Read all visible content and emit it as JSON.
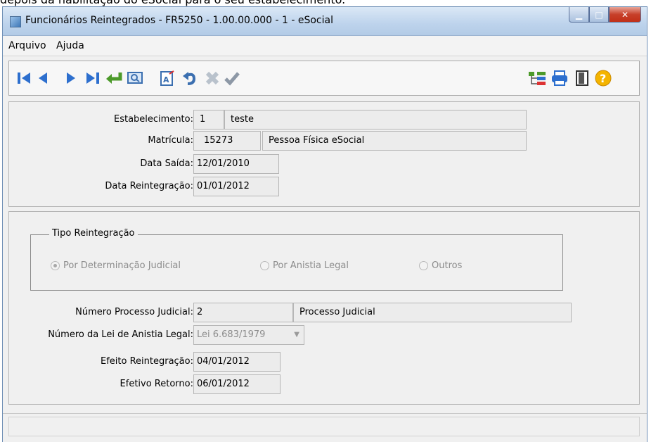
{
  "caption": "depois da habilitação do eSocial para o seu estabelecimento.",
  "window": {
    "title": "Funcionários Reintegrados - FR5250 - 1.00.00.000 - 1 - eSocial"
  },
  "menu": [
    "Arquivo",
    "Ajuda"
  ],
  "toolbar_icons": {
    "left": [
      "first-record-icon",
      "previous-record-icon",
      "next-record-icon",
      "last-record-icon",
      "goto-icon",
      "search-icon",
      "edit-icon",
      "undo-icon",
      "delete-icon",
      "confirm-icon"
    ],
    "right": [
      "tree-icon",
      "print-icon",
      "exit-icon",
      "help-icon"
    ]
  },
  "fields": {
    "estabelecimento": {
      "label": "Estabelecimento:",
      "code": "1",
      "name": "teste"
    },
    "matricula": {
      "label": "Matrícula:",
      "code": "15273",
      "name": "Pessoa Física eSocial"
    },
    "data_saida": {
      "label": "Data Saída:",
      "value": "12/01/2010"
    },
    "data_reintegracao": {
      "label": "Data Reintegração:",
      "value": "01/01/2012"
    }
  },
  "tipo_reintegracao": {
    "title": "Tipo Reintegração",
    "options": [
      "Por Determinação Judicial",
      "Por Anistia Legal",
      "Outros"
    ],
    "selected": "Por Determinação Judicial"
  },
  "processo": {
    "numero": {
      "label": "Número Processo Judicial:",
      "value": "2",
      "desc": "Processo Judicial"
    },
    "lei": {
      "label": "Número da Lei de Anistia Legal:",
      "value": "Lei 6.683/1979"
    },
    "efeito": {
      "label": "Efeito Reintegração:",
      "value": "04/01/2012"
    },
    "retorno": {
      "label": "Efetivo Retorno:",
      "value": "06/01/2012"
    }
  },
  "colors": {
    "titlebar": "#bdd3ec",
    "close": "#c7402a",
    "nav_blue": "#2d6fce",
    "accent_green": "#4c9a2a",
    "help_orange": "#f4b400"
  }
}
